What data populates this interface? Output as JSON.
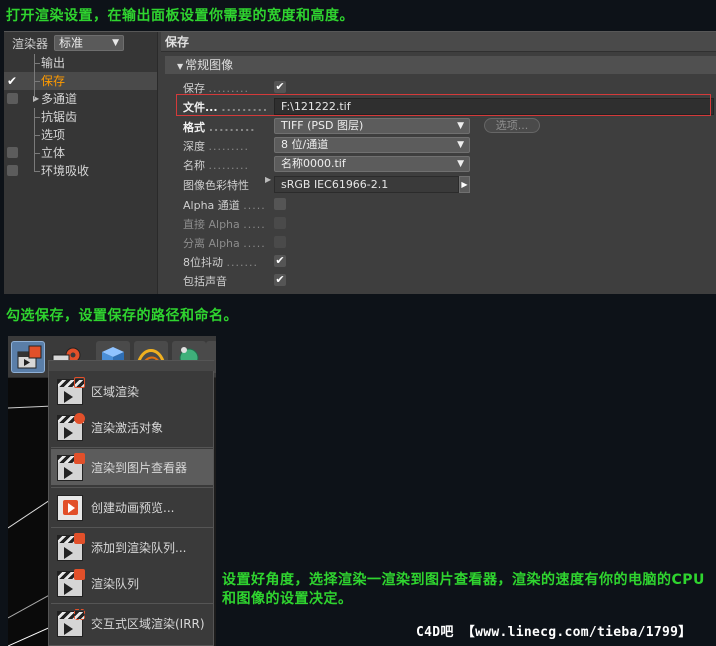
{
  "captions": {
    "step1": "打开渲染设置，在输出面板设置你需要的宽度和高度。",
    "step2": "勾选保存，设置保存的路径和命名。",
    "step3": "设置好角度，选择渲染一渲染到图片查看器，渲染的速度有你的电脑的CPU和图像的设置决定。",
    "watermark": "C4D吧 【www.linecg.com/tieba/1799】"
  },
  "render_settings": {
    "renderer_label": "渲染器",
    "renderer_value": "标准",
    "tree": [
      {
        "label": "输出",
        "checkbox": "none",
        "selected": false
      },
      {
        "label": "保存",
        "checkbox": "checked",
        "selected": true
      },
      {
        "label": "多通道",
        "checkbox": "unchecked",
        "selected": false,
        "expandable": true
      },
      {
        "label": "抗锯齿",
        "checkbox": "none",
        "selected": false
      },
      {
        "label": "选项",
        "checkbox": "none",
        "selected": false
      },
      {
        "label": "立体",
        "checkbox": "unchecked",
        "selected": false
      },
      {
        "label": "环境吸收",
        "checkbox": "unchecked",
        "selected": false
      }
    ],
    "pane_title": "保存",
    "group_title": "常规图像",
    "properties": {
      "save_label": "保存",
      "save_checked": "✔",
      "file_label": "文件...",
      "file_value": "F:\\121222.tif",
      "format_label": "格式",
      "format_value": "TIFF (PSD 图层)",
      "options_button": "选项...",
      "depth_label": "深度",
      "depth_value": "8 位/通道",
      "name_label": "名称",
      "name_value": "名称0000.tif",
      "color_profile_label": "图像色彩特性",
      "color_profile_value": "sRGB IEC61966-2.1",
      "alpha_label": "Alpha 通道",
      "straight_alpha_label": "直接 Alpha",
      "separate_alpha_label": "分离 Alpha",
      "dither_label": "8位抖动",
      "dither_checked": "✔",
      "sound_label": "包括声音",
      "sound_checked": "✔"
    },
    "dots": "........."
  },
  "render_menu": {
    "items": [
      {
        "label": "区域渲染",
        "icon": "region-render-icon"
      },
      {
        "label": "渲染激活对象",
        "icon": "render-active-objects-icon"
      },
      {
        "label": "渲染到图片查看器",
        "icon": "render-to-picture-viewer-icon",
        "hover": true
      },
      {
        "label": "创建动画预览...",
        "icon": "make-preview-icon"
      },
      {
        "label": "添加到渲染队列...",
        "icon": "add-to-render-queue-icon"
      },
      {
        "label": "渲染队列",
        "icon": "render-queue-icon"
      },
      {
        "label": "交互式区域渲染(IRR)",
        "icon": "interactive-render-region-icon"
      }
    ]
  },
  "colors": {
    "caption": "#2fd42f",
    "selected_tree": "#ff9b00",
    "highlight_border": "#d43a3a"
  }
}
